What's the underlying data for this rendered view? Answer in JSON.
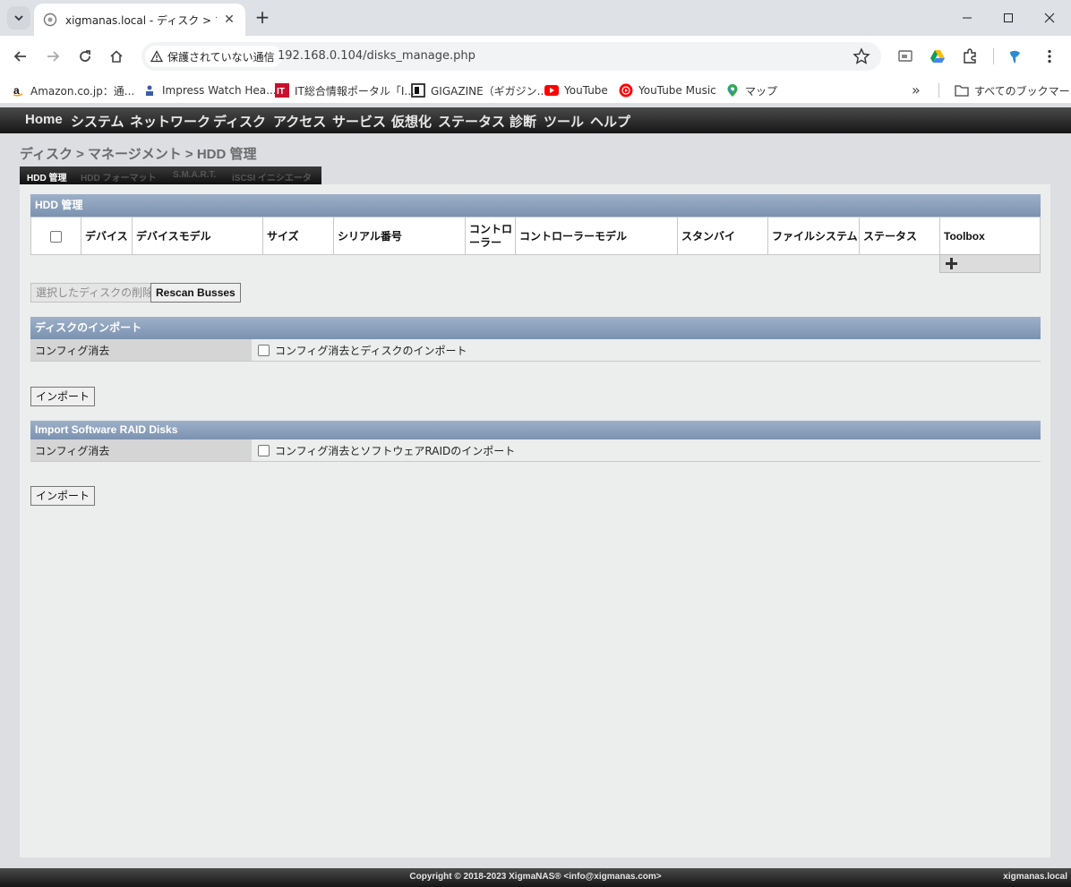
{
  "browser": {
    "tab_title": "xigmanas.local - ディスク > マネ-",
    "security_label": "保護されていない通信",
    "url": "192.168.0.104/disks_manage.php",
    "bookmarks": [
      {
        "label": "Amazon.co.jp：通...",
        "icon": "amazon-icon"
      },
      {
        "label": "Impress Watch Hea...",
        "icon": "impress-icon"
      },
      {
        "label": "IT総合情報ポータル「I...",
        "icon": "itmedia-icon"
      },
      {
        "label": "GIGAZINE（ギガジン...",
        "icon": "gigazine-icon"
      },
      {
        "label": "YouTube",
        "icon": "youtube-icon"
      },
      {
        "label": "YouTube Music",
        "icon": "youtube-music-icon"
      },
      {
        "label": "マップ",
        "icon": "maps-icon"
      }
    ],
    "all_bookmarks_label": "すべてのブックマーク"
  },
  "nav": {
    "items": [
      "Home",
      "システム",
      "ネットワーク",
      "ディスク",
      "アクセス",
      "サービス",
      "仮想化",
      "ステータス",
      "診断",
      "ツール",
      "ヘルプ"
    ]
  },
  "breadcrumb": "ディスク > マネージメント > HDD 管理",
  "subtabs": [
    "HDD 管理",
    "HDD フォーマット",
    "S.M.A.R.T.",
    "iSCSI イニシエータ"
  ],
  "hdd_section": {
    "title": "HDD 管理",
    "columns": [
      "デバイス",
      "デバイスモデル",
      "サイズ",
      "シリアル番号",
      "コントロ ーラー",
      "コントローラーモデル",
      "スタンバイ",
      "ファイルシステム",
      "ステータス",
      "Toolbox"
    ],
    "delete_button": "選択したディスクの削除",
    "rescan_button": "Rescan Busses"
  },
  "import_section": {
    "title": "ディスクのインポート",
    "label": "コンフィグ消去",
    "checkbox_text": "コンフィグ消去とディスクのインポート",
    "button": "インポート"
  },
  "raid_section": {
    "title": "Import Software RAID Disks",
    "label": "コンフィグ消去",
    "checkbox_text": "コンフィグ消去とソフトウェアRAIDのインポート",
    "button": "インポート"
  },
  "footer": {
    "copyright": "Copyright © 2018-2023 XigmaNAS® <info@xigmanas.com>",
    "hostname": "xigmanas.local"
  }
}
